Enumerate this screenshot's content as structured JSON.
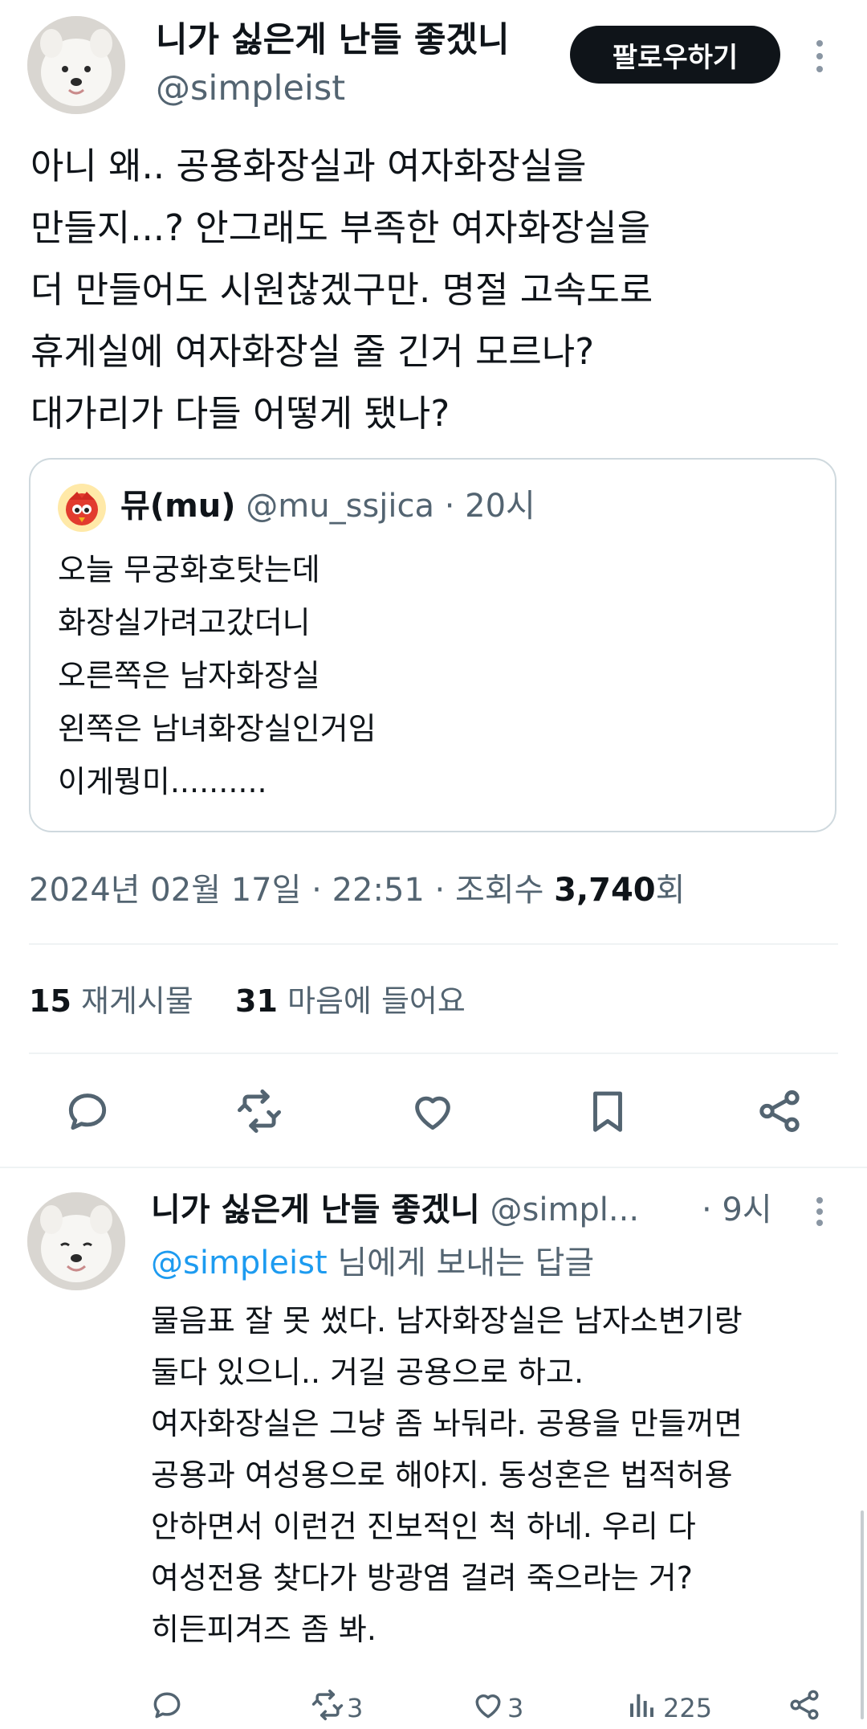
{
  "tweet": {
    "display_name": "니가 싫은게 난들 좋겠니",
    "handle": "@simpleist",
    "follow_label": "팔로우하기",
    "body_lines": [
      "아니 왜.. 공용화장실과 여자화장실을",
      "만들지...? 안그래도 부족한 여자화장실을",
      "더 만들어도 시원찮겠구만. 명절 고속도로",
      "휴게실에 여자화장실 줄 긴거 모르나?",
      "대가리가 다들 어떻게 됐나?"
    ],
    "quote": {
      "display_name": "뮤(mu)",
      "handle": "@mu_ssjica",
      "time": "· 20시",
      "lines": [
        "오늘 무궁화호탓는데",
        "화장실가려고갔더니",
        "오른쪽은 남자화장실",
        "왼쪽은 남녀화장실인거임",
        "이게뭥미.........."
      ]
    },
    "meta": {
      "datetime": "2024년 02월 17일 · 22:51 · 조회수 ",
      "views": "3,740",
      "views_suffix": "회"
    },
    "stats": {
      "retweets_count": "15",
      "retweets_label": "재게시물",
      "likes_count": "31",
      "likes_label": "마음에 들어요"
    },
    "actions": [
      "reply-icon",
      "retweet-icon",
      "like-icon",
      "bookmark-icon",
      "share-icon"
    ]
  },
  "reply": {
    "display_name": "니가 싫은게 난들 좋겠니",
    "handle": "@simpl...",
    "time": "· 9시",
    "replying_to_handle": "@simpleist",
    "replying_to_suffix": " 님에게 보내는 답글",
    "body_lines": [
      "물음표 잘 못 썼다. 남자화장실은 남자소변기랑",
      "둘다 있으니.. 거길 공용으로 하고.",
      "여자화장실은 그냥 좀 놔둬라. 공용을 만들꺼면",
      "공용과 여성용으로 해야지. 동성혼은 법적허용",
      "안하면서 이런건 진보적인 척 하네. 우리 다",
      "여성전용 찾다가 방광염 걸려 죽으라는 거?",
      "히든피겨즈 좀 봐."
    ],
    "actions": {
      "retweets": "3",
      "likes": "3",
      "views": "225"
    }
  },
  "colors": {
    "link": "#1d9bf0",
    "muted": "#536471",
    "text": "#0f1419",
    "border": "#cfd9de"
  }
}
